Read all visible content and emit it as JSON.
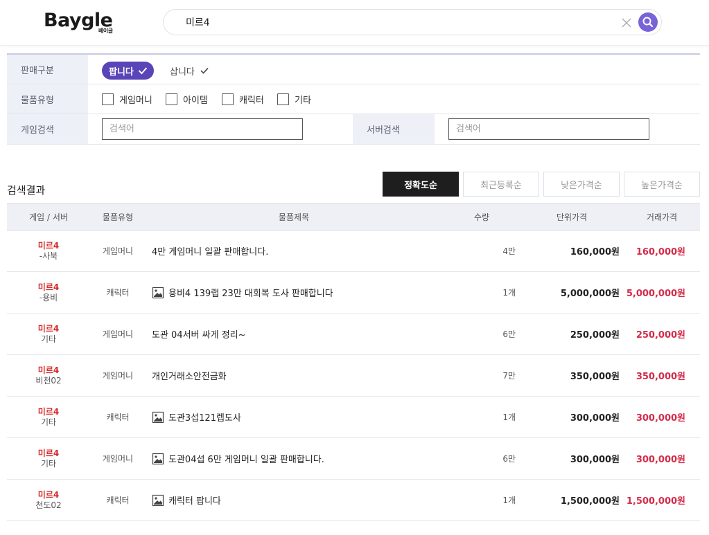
{
  "header": {
    "logo_main": "Baygle",
    "logo_sub": "베이글",
    "search_value": "미르4"
  },
  "filter": {
    "sale_label": "판매구분",
    "sell_label": "팝니다",
    "buy_label": "삽니다",
    "type_label": "물품유형",
    "types": [
      "게임머니",
      "아이템",
      "캐릭터",
      "기타"
    ],
    "game_search_label": "게임검색",
    "game_search_placeholder": "검색어",
    "server_search_label": "서버검색",
    "server_search_placeholder": "검색어"
  },
  "results": {
    "title": "검색결과",
    "sorts": [
      "정확도순",
      "최근등록순",
      "낮은가격순",
      "높은가격순"
    ],
    "active_sort": "정확도순"
  },
  "table": {
    "headers": [
      "게임 / 서버",
      "물품유형",
      "물품제목",
      "수량",
      "단위가격",
      "거래가격"
    ],
    "rows": [
      {
        "game": "미르4",
        "server": "-사북",
        "type": "게임머니",
        "title": "4만 게임머니 일괄 판매합니다.",
        "has_image": false,
        "qty": "4만",
        "unit_price": "160,000원",
        "total_price": "160,000원"
      },
      {
        "game": "미르4",
        "server": "-용비",
        "type": "캐릭터",
        "title": "용비4 139랩 23만 대회복 도사 판매합니다",
        "has_image": true,
        "qty": "1개",
        "unit_price": "5,000,000원",
        "total_price": "5,000,000원"
      },
      {
        "game": "미르4",
        "server": "기타",
        "type": "게임머니",
        "title": "도관 04서버 싸게 정리~",
        "has_image": false,
        "qty": "6만",
        "unit_price": "250,000원",
        "total_price": "250,000원"
      },
      {
        "game": "미르4",
        "server": "비천02",
        "type": "게임머니",
        "title": "개인거래소안전금화",
        "has_image": false,
        "qty": "7만",
        "unit_price": "350,000원",
        "total_price": "350,000원"
      },
      {
        "game": "미르4",
        "server": "기타",
        "type": "캐릭터",
        "title": "도관3섭121렙도사",
        "has_image": true,
        "qty": "1개",
        "unit_price": "300,000원",
        "total_price": "300,000원"
      },
      {
        "game": "미르4",
        "server": "기타",
        "type": "게임머니",
        "title": "도관04섭 6만 게임머니 일괄 판매합니다.",
        "has_image": true,
        "qty": "6만",
        "unit_price": "300,000원",
        "total_price": "300,000원"
      },
      {
        "game": "미르4",
        "server": "천도02",
        "type": "캐릭터",
        "title": "캐릭터 팝니다",
        "has_image": true,
        "qty": "1개",
        "unit_price": "1,500,000원",
        "total_price": "1,500,000원"
      }
    ]
  },
  "colors": {
    "accent": "#5944b8",
    "search_button": "#7863d8",
    "game_name": "#d42b2b",
    "total_price": "#d42b4a"
  }
}
